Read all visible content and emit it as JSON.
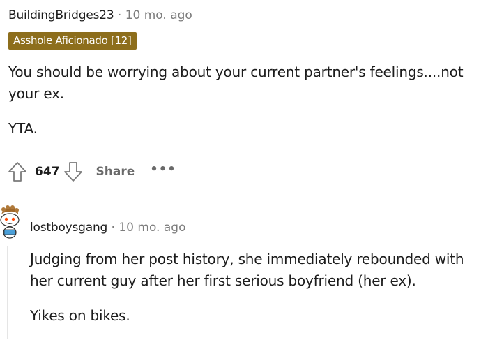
{
  "comment": {
    "username": "BuildingBridges23",
    "separator": "·",
    "timestamp": "10 mo. ago",
    "flair": "Asshole Aficionado [12]",
    "flair_color": "#8d6e1c",
    "paragraphs": [
      "You should be worrying about your current partner's feelings....not your ex.",
      "YTA."
    ],
    "score": "647",
    "share_label": "Share",
    "more_label": "•••",
    "upvote_icon": "arrow-up-outline-icon",
    "downvote_icon": "arrow-down-outline-icon"
  },
  "reply": {
    "avatar_icon": "snoo-avatar-icon",
    "username": "lostboysgang",
    "separator": "·",
    "timestamp": "10 mo. ago",
    "paragraphs": [
      "Judging from her post history, she immediately rebounded with her current guy after her first serious boyfriend (her ex).",
      "Yikes on bikes."
    ]
  }
}
